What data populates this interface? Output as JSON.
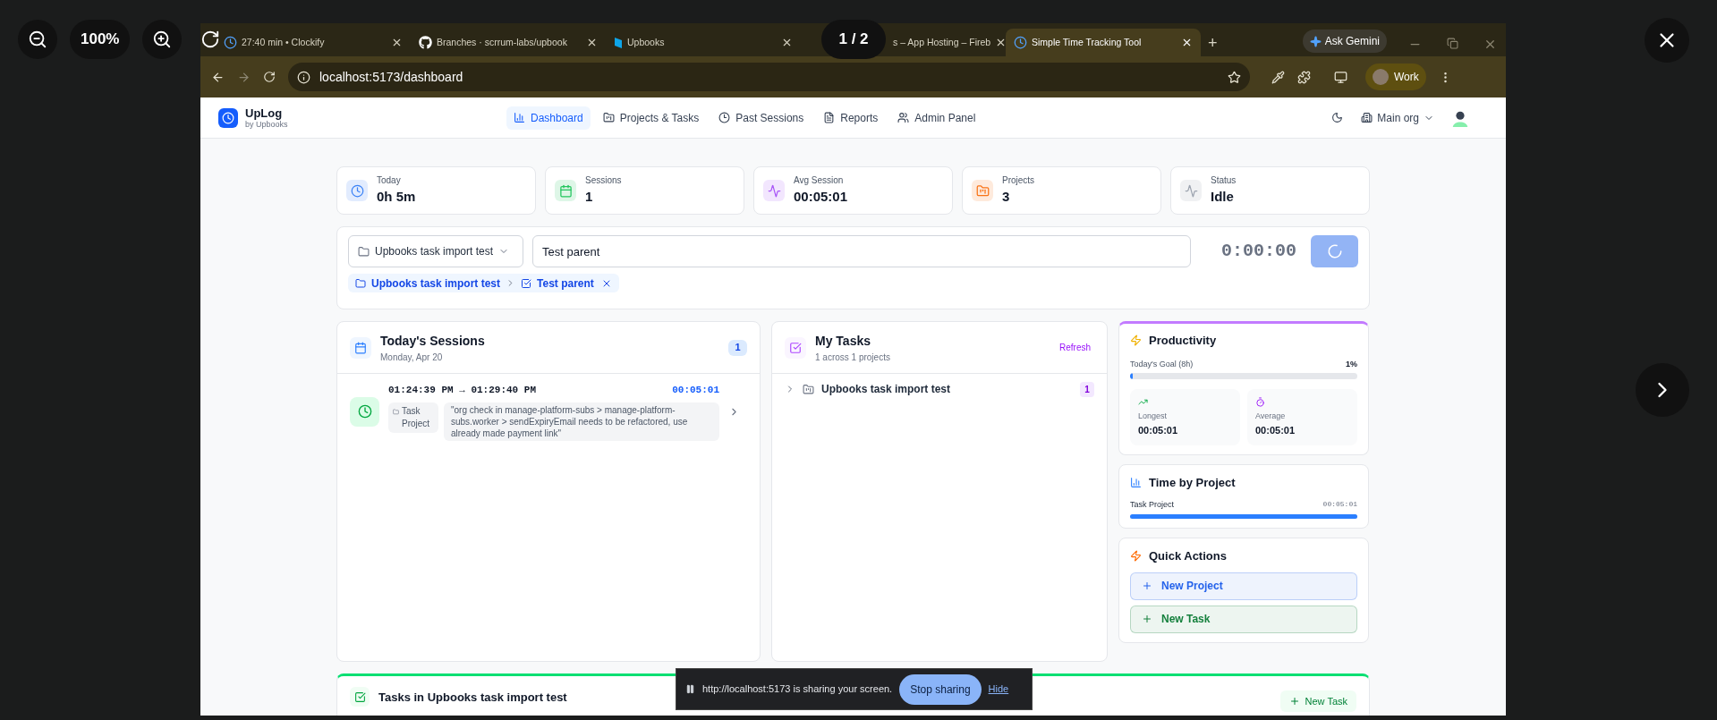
{
  "viewer": {
    "zoom_level": "100%",
    "page_counter": "1 / 2"
  },
  "browser": {
    "tabs": [
      {
        "title": "27:40 min • Clockify",
        "kind": "clock",
        "selected": false
      },
      {
        "title": "Branches · scrrum-labs/upbook",
        "kind": "github",
        "selected": false
      },
      {
        "title": "Upbooks",
        "kind": "upbooks",
        "selected": false
      },
      {
        "title": "s – App Hosting – Fireb",
        "kind": "firebase",
        "selected": false
      },
      {
        "title": "Simple Time Tracking Tool",
        "kind": "clock",
        "selected": true
      }
    ],
    "new_tab": "+",
    "ask_gemini": "Ask Gemini",
    "url": "localhost:5173/dashboard",
    "profile": "Work"
  },
  "app": {
    "brand": {
      "name": "UpLog",
      "subtitle": "by Upbooks"
    },
    "nav": [
      {
        "label": "Dashboard",
        "kind": "chart",
        "selected": true
      },
      {
        "label": "Projects & Tasks",
        "kind": "folder",
        "selected": false
      },
      {
        "label": "Past Sessions",
        "kind": "clock",
        "selected": false
      },
      {
        "label": "Reports",
        "kind": "file",
        "selected": false
      },
      {
        "label": "Admin Panel",
        "kind": "users",
        "selected": false
      }
    ],
    "org": "Main org",
    "stats": [
      {
        "label": "Today",
        "value": "0h 5m",
        "kind": "clock",
        "color": "#3b82f6"
      },
      {
        "label": "Sessions",
        "value": "1",
        "kind": "calendar",
        "color": "#22c55e"
      },
      {
        "label": "Avg Session",
        "value": "00:05:01",
        "kind": "activity",
        "color": "#a855f7"
      },
      {
        "label": "Projects",
        "value": "3",
        "kind": "folder",
        "color": "#f97316"
      },
      {
        "label": "Status",
        "value": "Idle",
        "kind": "activity",
        "color": "#9ca3af"
      }
    ],
    "timer": {
      "project_select": "Upbooks task import test",
      "task_input": "Test parent",
      "clock": "0:00:00",
      "loading": true,
      "breadcrumb": {
        "project": "Upbooks task import test",
        "task": "Test parent"
      }
    },
    "sessions": {
      "title": "Today's Sessions",
      "date": "Monday, Apr 20",
      "count": "1",
      "items": [
        {
          "time_range": "01:24:39 PM → 01:29:40 PM",
          "duration": "00:05:01",
          "project": "Task Project",
          "description": "\"org check in manage-platform-subs > manage-platform-subs.worker > sendExpiryEmail needs to be refactored, use already made payment link\""
        }
      ]
    },
    "tasks": {
      "title": "My Tasks",
      "subtitle": "1 across 1 projects",
      "refresh": "Refresh",
      "groups": [
        {
          "name": "Upbooks task import test",
          "count": "1",
          "expanded": false
        }
      ]
    },
    "productivity": {
      "title": "Productivity",
      "goal_label": "Today's Goal (8h)",
      "percent": "1%",
      "level": 0.01,
      "longest": {
        "label": "Longest",
        "value": "00:05:01"
      },
      "average": {
        "label": "Average",
        "value": "00:05:01"
      }
    },
    "time_by_project": {
      "title": "Time by Project",
      "rows": [
        {
          "name": "Task Project",
          "time": "00:05:01",
          "level": 1
        }
      ]
    },
    "quick_actions": {
      "title": "Quick Actions",
      "buttons": [
        {
          "label": "New Project",
          "color": "#2563eb"
        },
        {
          "label": "New Task",
          "color": "#15803d"
        }
      ]
    },
    "project_tasks": {
      "title": "Tasks in Upbooks task import test",
      "new_task": "New Task"
    }
  },
  "share_bar": {
    "message": "http://localhost:5173 is sharing your screen.",
    "stop": "Stop sharing",
    "hide": "Hide"
  }
}
